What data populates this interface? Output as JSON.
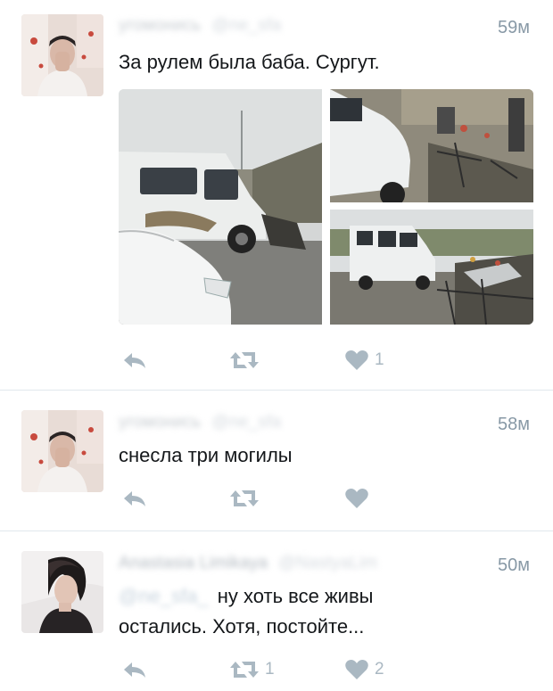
{
  "colors": {
    "action_icon": "#aab8c2",
    "timestamp": "#8899a6",
    "separator": "#e1e8ed",
    "text": "#14171a"
  },
  "tweets": [
    {
      "name": "угомонись",
      "handle": "@ne_sfa",
      "time": "59м",
      "text_lines": [
        "За рулем была баба. Сургут."
      ],
      "has_media": true,
      "retweet_count": "",
      "like_count": "1"
    },
    {
      "name": "угомонись",
      "handle": "@ne_sfa",
      "time": "58м",
      "text_lines": [
        "снесла три могилы"
      ],
      "has_media": false,
      "retweet_count": "",
      "like_count": ""
    },
    {
      "name": "Anastasia Limikaya",
      "handle": "@NastyaLim",
      "time": "50м",
      "mention": "@ne_sfa_",
      "text_lines": [
        "ну хоть все живы",
        "остались. Хотя, постойте..."
      ],
      "has_media": false,
      "retweet_count": "1",
      "like_count": "2"
    }
  ],
  "icons": {
    "reply": "reply-icon",
    "retweet": "retweet-icon",
    "like": "heart-icon"
  }
}
